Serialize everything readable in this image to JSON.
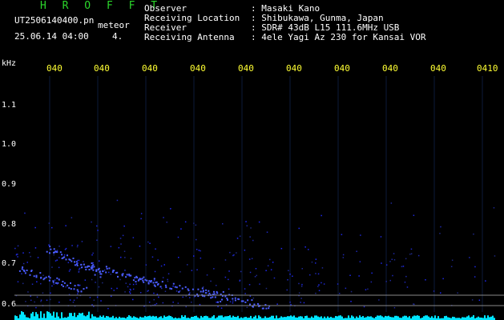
{
  "app": {
    "title": "H R O F F T"
  },
  "file": {
    "name": "UT2506140400.pn",
    "mode": "meteor",
    "datetime": "25.06.14 04:00",
    "counter": "4."
  },
  "meta": [
    {
      "key": "Observer",
      "value": ": Masaki Kano"
    },
    {
      "key": "Receiving Location",
      "value": ": Shibukawa, Gunma, Japan"
    },
    {
      "key": "Receiver",
      "value": ": SDR# 43dB L15 111.6MHz USB"
    },
    {
      "key": "Receiving Antenna",
      "value": ": 4ele Yagi Az 230 for Kansai VOR"
    }
  ],
  "axis": {
    "y_unit": "kHz",
    "y_ticks": [
      "1.1",
      "1.0",
      "0.9",
      "0.8",
      "0.7",
      "0.6"
    ],
    "x_ticks": [
      "040",
      "040",
      "040",
      "040",
      "040",
      "040",
      "040",
      "040",
      "040",
      "0410"
    ]
  },
  "colors": {
    "background": "#000000",
    "header": "#2bd62b",
    "labels": "#ffffff",
    "time_ticks": "#ffff33",
    "signal": "#3b4cff",
    "baseline": "#00ffff"
  }
}
